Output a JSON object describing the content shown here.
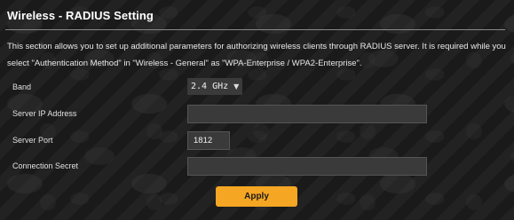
{
  "page": {
    "title": "Wireless - RADIUS Setting",
    "description": "This section allows you to set up additional parameters for authorizing wireless clients through RADIUS server. It is required while you select \"Authentication Method\" in \"Wireless - General\" as \"WPA-Enterprise / WPA2-Enterprise\"."
  },
  "form": {
    "band": {
      "label": "Band",
      "value": "2.4 GHz"
    },
    "server_ip": {
      "label": "Server IP Address",
      "value": ""
    },
    "server_port": {
      "label": "Server Port",
      "value": "1812"
    },
    "connection_secret": {
      "label": "Connection Secret",
      "value": ""
    }
  },
  "actions": {
    "apply_label": "Apply"
  },
  "colors": {
    "accent": "#f5a623",
    "background": "#161616",
    "field": "#3a3a3a"
  },
  "icons": {
    "band_dropdown": "chevron-down-icon"
  }
}
